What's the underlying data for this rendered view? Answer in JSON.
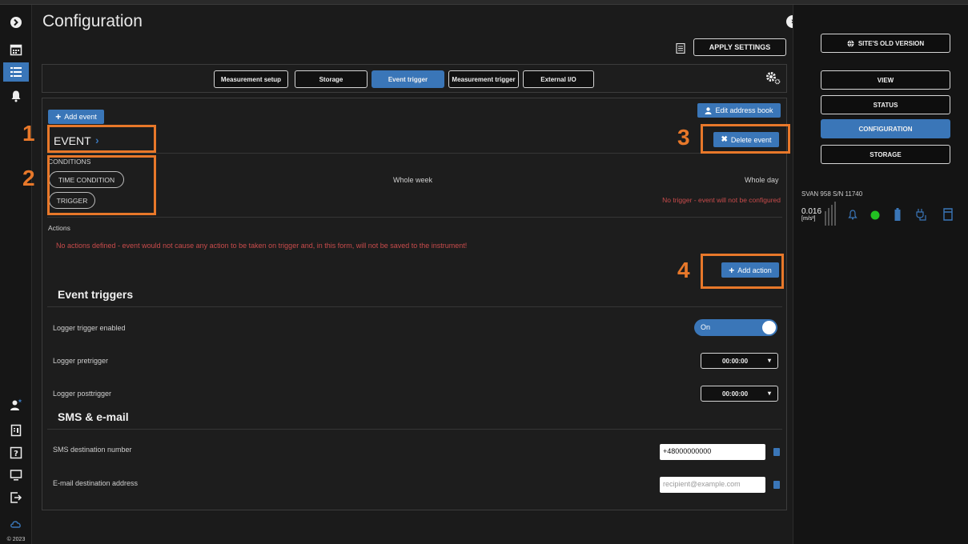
{
  "page": {
    "title": "Configuration"
  },
  "rail": {
    "copyright": "© 2023"
  },
  "toolbar": {
    "apply_label": "APPLY SETTINGS"
  },
  "tabs": [
    {
      "label": "Measurement setup",
      "active": false
    },
    {
      "label": "Storage",
      "active": false
    },
    {
      "label": "Event trigger",
      "active": true
    },
    {
      "label": "Measurement trigger",
      "active": false
    },
    {
      "label": "External I/O",
      "active": false
    }
  ],
  "event": {
    "add_event_label": "Add event",
    "edit_address_book_label": "Edit address book",
    "title": "EVENT",
    "delete_event_label": "Delete event",
    "conditions_label": "CONDITIONS",
    "time_condition_label": "TIME CONDITION",
    "trigger_label": "TRIGGER",
    "time_week": "Whole week",
    "time_day": "Whole day",
    "trigger_warning": "No trigger - event will not be configured",
    "actions_label": "Actions",
    "actions_warning": "No actions defined - event would not cause any action to be taken on trigger and, in this form, will not be saved to the instrument!",
    "add_action_label": "Add action"
  },
  "annotations": [
    "1",
    "2",
    "3",
    "4"
  ],
  "event_triggers": {
    "title": "Event triggers",
    "logger_trigger_label": "Logger trigger enabled",
    "logger_trigger_value": "On",
    "pretrigger_label": "Logger pretrigger",
    "pretrigger_value": "00:00:00",
    "posttrigger_label": "Logger posttrigger",
    "posttrigger_value": "00:00:00"
  },
  "sms_email": {
    "title": "SMS & e-mail",
    "sms_label": "SMS destination number",
    "sms_value": "+48000000000",
    "email_label": "E-mail destination address",
    "email_placeholder": "recipient@example.com"
  },
  "right_panel": {
    "old_version_label": "SITE'S OLD VERSION",
    "nav": [
      {
        "label": "VIEW",
        "active": false
      },
      {
        "label": "STATUS",
        "active": false
      },
      {
        "label": "CONFIGURATION",
        "active": true
      },
      {
        "label": "STORAGE",
        "active": false
      }
    ],
    "device_name": "SVAN 958 S/N 11740",
    "meter_value": "0.016",
    "meter_unit": "[m/s²]"
  },
  "colors": {
    "accent": "#3a76b8",
    "annotation": "#e8782a",
    "warning": "#c84b4b",
    "status_ok": "#22c022"
  }
}
